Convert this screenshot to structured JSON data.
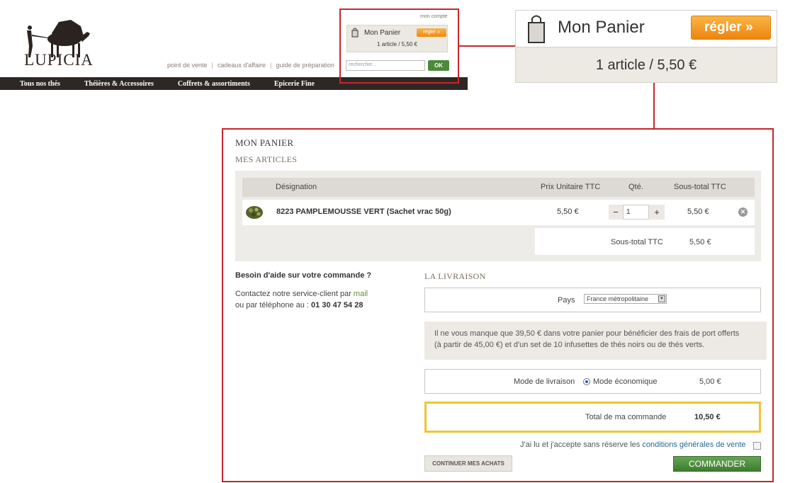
{
  "brand": {
    "logo_text": "LUPICIA"
  },
  "header": {
    "links": [
      "point de vente",
      "cadeaux d'affaire",
      "guide de préparation"
    ],
    "separator": "|",
    "account_link": "mon compte",
    "search_placeholder": "rechercher...",
    "search_button": "OK"
  },
  "nav": [
    "Tous nos thés",
    "Théières & Accessoires",
    "Coffrets & assortiments",
    "Epicerie Fine"
  ],
  "mini_cart": {
    "title": "Mon Panier",
    "checkout_label": "régler",
    "checkout_arrows": "»",
    "summary": "1  article / 5,50 €"
  },
  "cart_zoom": {
    "title": "Mon Panier",
    "checkout_label": "régler",
    "checkout_arrows": "»",
    "summary": "1  article / 5,50 €"
  },
  "panel": {
    "title": "MON PANIER",
    "subtitle": "MES ARTICLES",
    "table": {
      "headers": {
        "designation": "Désignation",
        "unit_price": "Prix Unitaire TTC",
        "qty": "Qté.",
        "subtotal": "Sous-total TTC"
      },
      "rows": [
        {
          "name": "8223 PAMPLEMOUSSE VERT (Sachet vrac 50g)",
          "unit_price": "5,50 €",
          "qty": "1",
          "subtotal": "5,50 €"
        }
      ],
      "minus": "−",
      "plus": "+",
      "remove": "✕"
    },
    "subtotal": {
      "label": "Sous-total TTC",
      "value": "5,50 €"
    },
    "help": {
      "title": "Besoin d'aide sur votre commande ?",
      "line1_prefix": "Contactez notre service-client par ",
      "line1_link": "mail",
      "line2_prefix": "ou par téléphone au : ",
      "phone": "01 30 47 54 28"
    },
    "delivery": {
      "title": "LA LIVRAISON",
      "country_label": "Pays",
      "country_value": "France métropolitaine",
      "promo_line1": "Il ne vous manque que 39,50 € dans votre panier pour bénéficier des frais de port offerts",
      "promo_line2": "(à partir de 45,00 €) et d'un set de 10 infusettes de thés noirs ou de thés verts.",
      "mode_label": "Mode de livraison",
      "mode_option": "Mode économique",
      "mode_price": "5,00 €"
    },
    "total": {
      "label": "Total de ma commande",
      "value": "10,50 €"
    },
    "cgv": {
      "prefix": "J'ai lu et j'accepte sans réserve les ",
      "link": "conditions générales de vente"
    },
    "continue_button": "CONTINUER MES ACHATS",
    "order_button": "COMMANDER"
  },
  "colors": {
    "accent_red": "#c8242c",
    "checkout_orange": "#ee8a12",
    "order_green": "#3e7d30",
    "total_border": "#efc531"
  }
}
